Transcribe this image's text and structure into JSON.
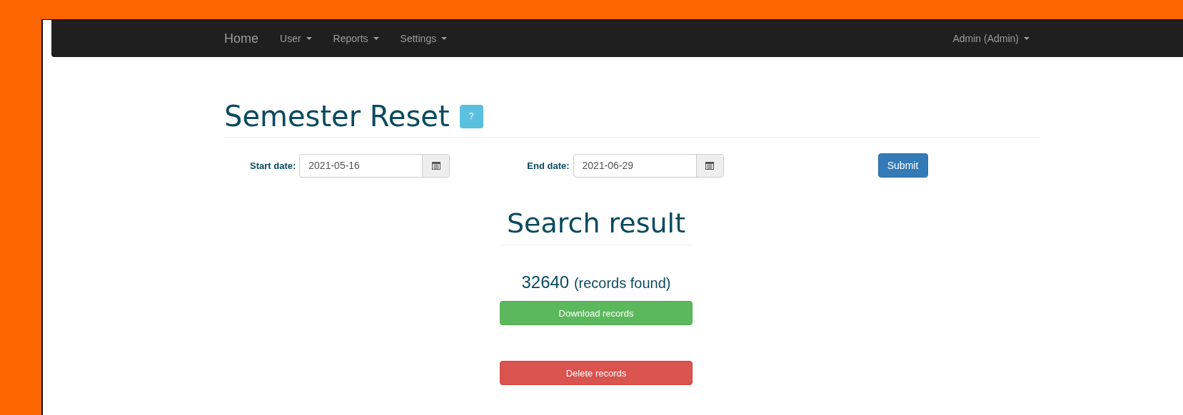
{
  "navbar": {
    "brand": "Home",
    "menus": [
      {
        "label": "User"
      },
      {
        "label": "Reports"
      },
      {
        "label": "Settings"
      }
    ],
    "user_menu": {
      "label": "Admin (Admin)"
    }
  },
  "page": {
    "title": "Semester Reset",
    "help_button": "?"
  },
  "form": {
    "fields": [
      {
        "label": "Start date:",
        "value": "2021-05-16"
      },
      {
        "label": "End date:",
        "value": "2021-06-29"
      }
    ],
    "submit": "Submit"
  },
  "result": {
    "heading": "Search result",
    "count": "32640",
    "count_note": "(records found)",
    "buttons": [
      {
        "kind": "download",
        "label": "Download records"
      },
      {
        "kind": "delete",
        "label": "Delete records"
      }
    ]
  }
}
